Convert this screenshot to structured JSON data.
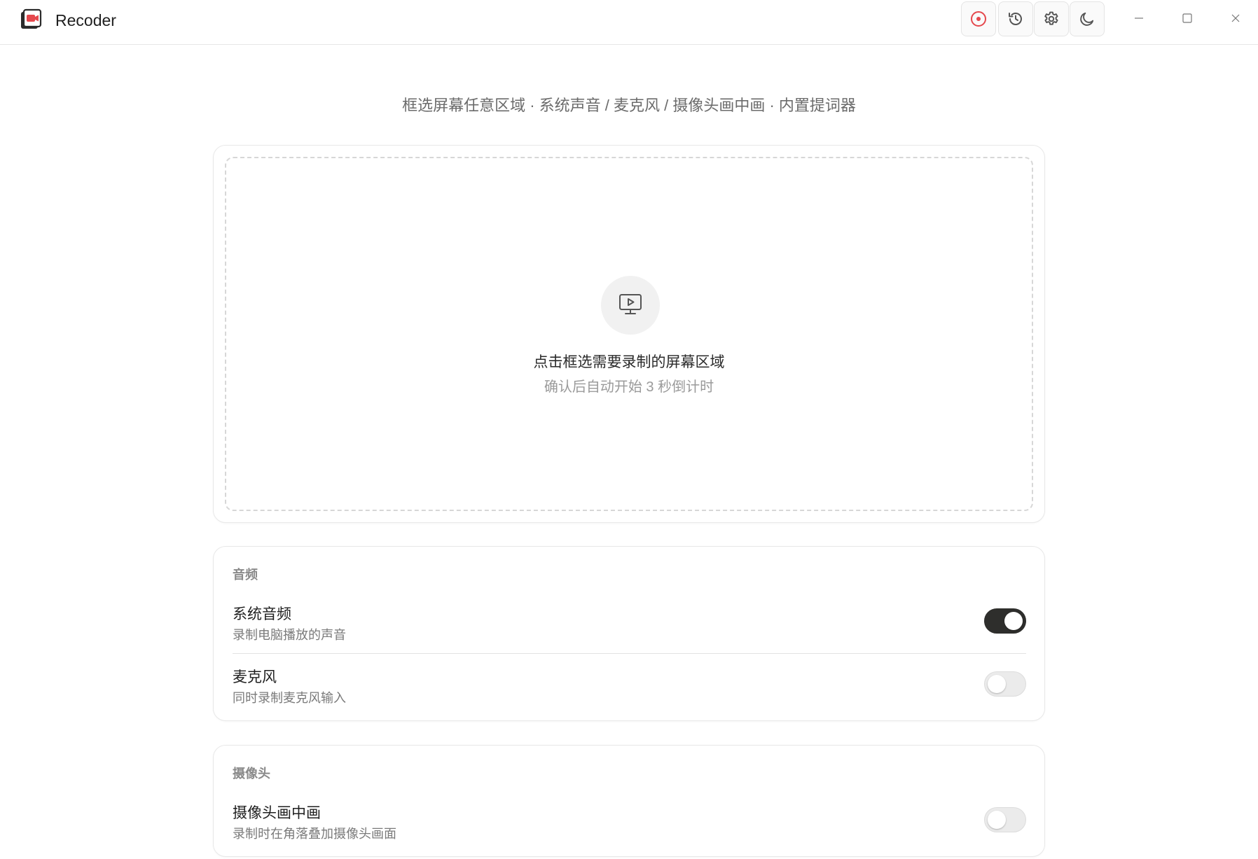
{
  "app": {
    "title": "Recoder"
  },
  "toolbar": {
    "record_icon": "record-icon",
    "history_icon": "history-icon",
    "settings_icon": "gear-icon",
    "theme_icon": "moon-icon"
  },
  "window_controls": {
    "minimize_icon": "minimize-icon",
    "maximize_icon": "maximize-icon",
    "close_icon": "close-icon"
  },
  "main": {
    "subtitle": "框选屏幕任意区域 · 系统声音 / 麦克风 / 摄像头画中画 · 内置提词器",
    "record_area": {
      "icon": "monitor-play-icon",
      "title": "点击框选需要录制的屏幕区域",
      "hint": "确认后自动开始 3 秒倒计时"
    }
  },
  "audio": {
    "section_title": "音频",
    "items": [
      {
        "label": "系统音频",
        "desc": "录制电脑播放的声音",
        "enabled": true
      },
      {
        "label": "麦克风",
        "desc": "同时录制麦克风输入",
        "enabled": false
      }
    ]
  },
  "camera": {
    "section_title": "摄像头",
    "items": [
      {
        "label": "摄像头画中画",
        "desc": "录制时在角落叠加摄像头画面",
        "enabled": false
      }
    ]
  },
  "colors": {
    "accent_record": "#e5484d",
    "toggle_on": "#2e2e2c",
    "toggle_off": "#ebebeb"
  }
}
